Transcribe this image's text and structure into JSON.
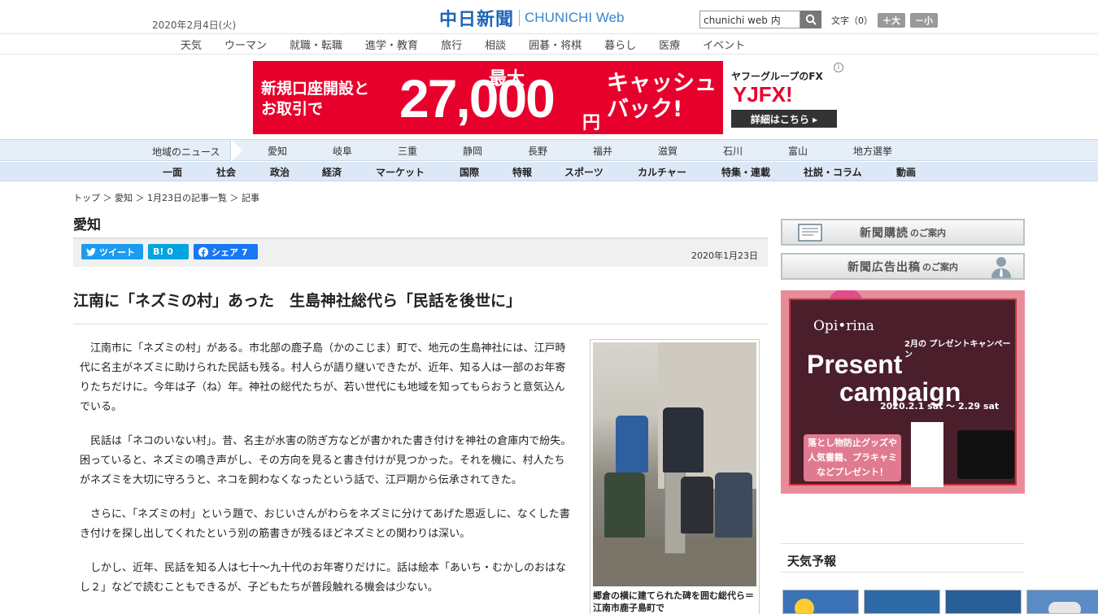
{
  "header": {
    "date": "2020年2月4日(火)",
    "logo_jp": "中日新聞",
    "logo_en": "CHUNICHI Web",
    "search_value": "chunichi web 内",
    "font_label": "文字（0）",
    "font_up": "＋大",
    "font_down": "－小"
  },
  "category_nav": [
    "天気",
    "ウーマン",
    "就職・転職",
    "進学・教育",
    "旅行",
    "相談",
    "囲碁・将棋",
    "暮らし",
    "医療",
    "イベント"
  ],
  "ad": {
    "left_text_1": "新規口座開設と",
    "left_text_2": "お取引で",
    "max": "最大",
    "amount": "27,000",
    "yen": "円",
    "cash_1": "キャッシュ",
    "cash_2": "バック!",
    "group": "ヤフーグループのFX",
    "brand": "YJFX!",
    "detail": "詳細はこちら ▸"
  },
  "region_nav": {
    "label": "地域のニュース",
    "items": [
      "愛知",
      "岐阜",
      "三重",
      "静岡",
      "長野",
      "福井",
      "滋賀",
      "石川",
      "富山",
      "地方選挙"
    ]
  },
  "section_nav": [
    "一面",
    "社会",
    "政治",
    "経済",
    "マーケット",
    "国際",
    "特報",
    "スポーツ",
    "カルチャー",
    "特集・連載",
    "社説・コラム",
    "動画"
  ],
  "breadcrumb": "トップ ＞ 愛知 ＞ 1月23日の記事一覧 ＞ 記事",
  "section_title": "愛知",
  "share": {
    "tweet": "ツイート",
    "hatena": "B! 0",
    "facebook": "シェア 7"
  },
  "article": {
    "date": "2020年1月23日",
    "headline": "江南に「ネズミの村」あった　生島神社総代ら「民話を後世に」",
    "paragraphs": [
      "江南市に「ネズミの村」がある。市北部の鹿子島（かのこじま）町で、地元の生島神社には、江戸時代に名主がネズミに助けられた民話も残る。村人らが語り継いできたが、近年、知る人は一部のお年寄りたちだけに。今年は子（ね）年。神社の総代たちが、若い世代にも地域を知ってもらおうと意気込んでいる。",
      "民話は「ネコのいない村」。昔、名主が水害の防ぎ方などが書かれた書き付けを神社の倉庫内で紛失。困っていると、ネズミの鳴き声がし、その方向を見ると書き付けが見つかった。それを機に、村人たちがネズミを大切に守ろうと、ネコを飼わなくなったという話で、江戸期から伝承されてきた。",
      "さらに、「ネズミの村」という題で、おじいさんがわらをネズミに分けてあげた恩返しに、なくした書き付けを探し出してくれたという別の筋書きが残るほどネズミとの関わりは深い。",
      "しかし、近年、民話を知る人は七十～九十代のお年寄りだけに。話は絵本「あいち・むかしのおはなし２」などで読むこともできるが、子どもたちが普段触れる機会は少ない。"
    ],
    "caption": "郷倉の横に建てられた碑を囲む総代ら＝江南市鹿子島町で"
  },
  "sidebar": {
    "subscribe_main": "新聞購読",
    "subscribe_sub": "のご案内",
    "ad_main": "新聞広告出稿",
    "ad_sub": "のご案内",
    "promo_brand": "Opi•rina",
    "promo_campaign": "2月の プレゼントキャンペーン",
    "promo_title_1": "Present",
    "promo_title_2": "campaign",
    "promo_date": "2020.2.1 sat ～ 2.29 sat",
    "promo_msg": "落とし物防止グッズや 人気書籍、プラキャミ などプレゼント！",
    "weather_title": "天気予報"
  },
  "colors": {
    "brand_blue": "#1f64b8",
    "ad_red": "#e8002c",
    "twitter": "#1d9bf0",
    "facebook": "#1877f2",
    "hatena": "#00a4de"
  }
}
